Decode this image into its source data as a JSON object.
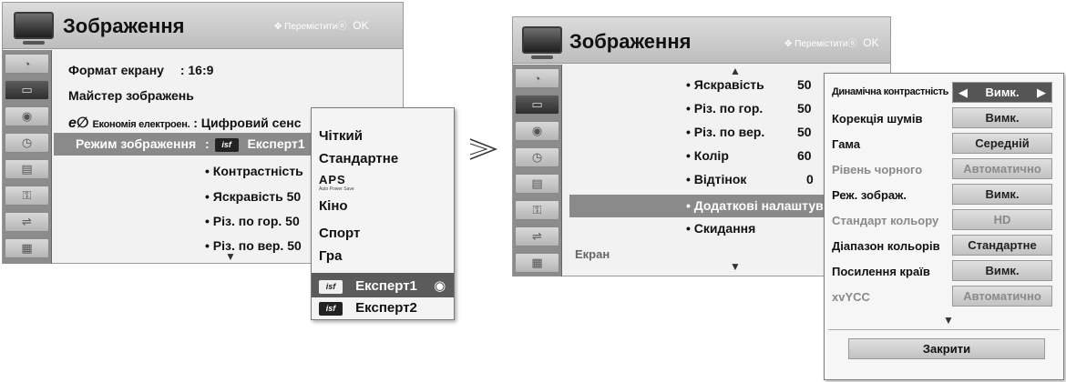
{
  "screens": {
    "left": {
      "title": "Зображення",
      "nav": {
        "move": "Переміститиⓞ",
        "ok": "OK"
      },
      "rows": [
        {
          "label": "Формат екрану",
          "value": ": 16:9"
        },
        {
          "label": "Майстер зображень",
          "value": ""
        },
        {
          "label": "Економія електроен.",
          "value": ": Цифровий сенс"
        },
        {
          "label": "Режим зображення",
          "value": ": Експерт1"
        }
      ],
      "eco_icon": "eco-icon",
      "sub_rows": [
        "• Контрастність",
        "• Яскравість  50",
        "• Різ. по гор.  50",
        "• Різ. по вер.  50"
      ],
      "popup": {
        "items": [
          "Чіткий",
          "Стандартне",
          "Кіно",
          "Спорт",
          "Гра",
          "Експерт1",
          "Експерт2"
        ],
        "aps_label": "APS",
        "aps_sub": "Auto Power Save",
        "selected": "Експерт1",
        "badge": "isf"
      }
    },
    "right": {
      "title": "Зображення",
      "nav": {
        "move": "Переміститиⓞ",
        "ok": "OK"
      },
      "rows": [
        {
          "label": "• Яскравість",
          "value": "50"
        },
        {
          "label": "• Різ. по гор.",
          "value": "50"
        },
        {
          "label": "• Різ. по вер.",
          "value": "50"
        },
        {
          "label": "• Колір",
          "value": "60"
        },
        {
          "label": "• Відтінок",
          "value": "0"
        },
        {
          "label": "• Додаткові налаштува",
          "value": ""
        },
        {
          "label": "• Скидання",
          "value": ""
        }
      ],
      "footer_label": "Екран",
      "advanced": {
        "items": [
          {
            "label": "Динамічна контрастність",
            "value": "Вимк.",
            "state": "active"
          },
          {
            "label": "Корекція шумів",
            "value": "Вимк.",
            "state": "normal"
          },
          {
            "label": "Гама",
            "value": "Середній",
            "state": "normal"
          },
          {
            "label": "Рівень чорного",
            "value": "Автоматично",
            "state": "dim"
          },
          {
            "label": "Реж. зображ.",
            "value": "Вимк.",
            "state": "normal"
          },
          {
            "label": "Стандарт кольору",
            "value": "HD",
            "state": "dim"
          },
          {
            "label": "Діапазон кольорів",
            "value": "Стандартне",
            "state": "normal"
          },
          {
            "label": "Посилення країв",
            "value": "Вимк.",
            "state": "normal"
          },
          {
            "label": "xvYCC",
            "value": "Автоматично",
            "state": "dim"
          }
        ],
        "close": "Закрити"
      }
    }
  },
  "colors": {
    "header": "#c9c9c9",
    "highlight": "#8a8a8a",
    "sidebar": "#8c8c8c",
    "selected": "#5b5b5b"
  }
}
